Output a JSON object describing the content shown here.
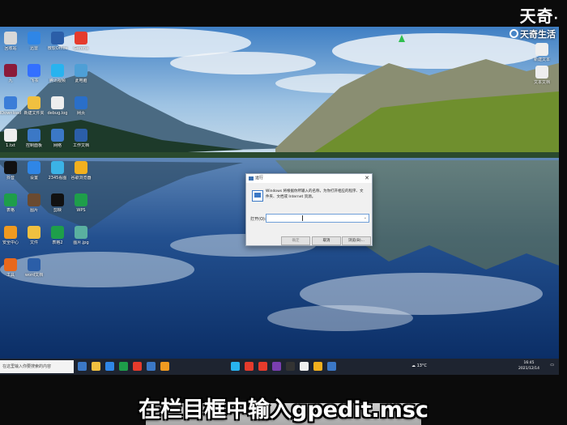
{
  "watermark": {
    "brand": "天奇",
    "sub": "天奇生活"
  },
  "caption": "在栏目框中输入gpedit.msc",
  "desktop_icons": [
    {
      "label": "回收站",
      "color": "#d8d8d8"
    },
    {
      "label": "迅雷",
      "color": "#2f86e6"
    },
    {
      "label": "微软Office",
      "color": "#2b5ea8"
    },
    {
      "label": "Garena",
      "color": "#e53b2c"
    },
    {
      "label": "九",
      "color": "#8b1a3a"
    },
    {
      "label": "飞书",
      "color": "#3370ff"
    },
    {
      "label": "腾讯视频",
      "color": "#28b3ef"
    },
    {
      "label": "此电脑",
      "color": "#4e9fd6"
    },
    {
      "label": "IDownload",
      "color": "#3b7dd8"
    },
    {
      "label": "新建文件夹",
      "color": "#f0c040"
    },
    {
      "label": "debug.log",
      "color": "#eeeeee"
    },
    {
      "label": "网页",
      "color": "#2a6fc9"
    },
    {
      "label": "1.txt",
      "color": "#eeeeee"
    },
    {
      "label": "控制面板",
      "color": "#3b78c6"
    },
    {
      "label": "网络",
      "color": "#3b78c6"
    },
    {
      "label": "工作文档",
      "color": "#2b5ea8"
    },
    {
      "label": "抖音",
      "color": "#111111"
    },
    {
      "label": "设置",
      "color": "#2f86e6"
    },
    {
      "label": "2345看图",
      "color": "#3bb3e6"
    },
    {
      "label": "谷歌浏览器",
      "color": "#f2b01e"
    },
    {
      "label": "表格",
      "color": "#1e9e4a"
    },
    {
      "label": "图片",
      "color": "#6a4a30"
    },
    {
      "label": "剪映",
      "color": "#111111"
    },
    {
      "label": "WPS",
      "color": "#1e9e4a"
    },
    {
      "label": "安全中心",
      "color": "#f09a20"
    },
    {
      "label": "文件",
      "color": "#f0c040"
    },
    {
      "label": "表格2",
      "color": "#1e9e4a"
    },
    {
      "label": "图片.jpg",
      "color": "#5ab0a0"
    },
    {
      "label": "工具",
      "color": "#e7681c"
    },
    {
      "label": "word文档",
      "color": "#2b5ea8"
    }
  ],
  "right_icons": [
    {
      "label": "新建文本",
      "color": "#eeeeee"
    },
    {
      "label": "文本文档",
      "color": "#eeeeee"
    }
  ],
  "run_dialog": {
    "title": "运行",
    "description": "Windows 将根据你所输入的名称，为你打开相应的程序、文件夹、文档或 Internet 资源。",
    "open_label": "打开(O):",
    "input_value": "",
    "ok": "确定",
    "cancel": "取消",
    "browse": "浏览(B)..."
  },
  "taskbar": {
    "search_placeholder": "在这里输入你要搜索的内容",
    "weather": "13°C",
    "time": "16:45",
    "date": "2021/12/14",
    "apps": [
      "#3b78c6",
      "#f0c040",
      "#2f86e6",
      "#1e9e4a",
      "#e53b2c",
      "#3b78c6",
      "#f09a20",
      "#28b3ef",
      "#e53b2c",
      "#e53b2c",
      "#7a3fb0",
      "#333333",
      "#eeeeee",
      "#f2b01e",
      "#3b78c6"
    ]
  },
  "colors": {
    "taskbar": "#1e2430",
    "dialog": "#f0f0f0",
    "accent": "#3b78c6"
  }
}
